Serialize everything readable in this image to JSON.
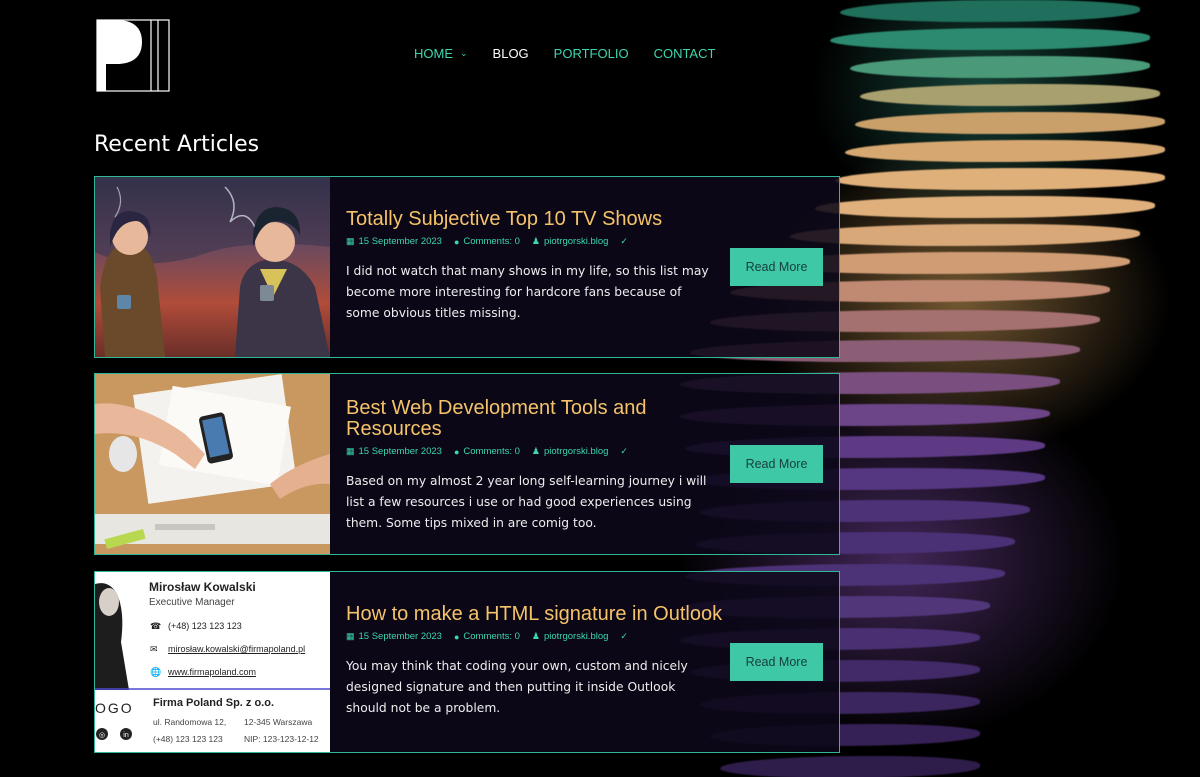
{
  "logo": {
    "text": "PI"
  },
  "nav": {
    "items": [
      {
        "label": "HOME",
        "active": false,
        "has_dropdown": true
      },
      {
        "label": "BLOG",
        "active": true,
        "has_dropdown": false
      },
      {
        "label": "PORTFOLIO",
        "active": false,
        "has_dropdown": false
      },
      {
        "label": "CONTACT",
        "active": false,
        "has_dropdown": false
      }
    ]
  },
  "section_title": "Recent Articles",
  "articles": [
    {
      "title": "Totally Subjective Top 10 TV Shows",
      "date": "15 September 2023",
      "comments": "Comments: 0",
      "author": "piotrgorski.blog",
      "excerpt": "I did not watch that many shows in my life, so this list may become more interesting for hardcore fans because of some obvious titles missing.",
      "read_more": "Read More",
      "image": "anime-characters-smoking"
    },
    {
      "title": "Best Web Development Tools and Resources",
      "date": "15 September 2023",
      "comments": "Comments: 0",
      "author": "piotrgorski.blog",
      "excerpt": "Based on my almost 2 year long self-learning journey i will list a few resources i use or had good experiences using them. Some tips mixed in are comig too.",
      "read_more": "Read More",
      "image": "desk-with-sketches-and-phone"
    },
    {
      "title": "How to make a HTML signature in Outlook",
      "date": "15 September 2023",
      "comments": "Comments: 0",
      "author": "piotrgorski.blog",
      "excerpt": "You may think that coding your own, custom and nicely designed signature and then putting it inside Outlook should not be a problem.",
      "read_more": "Read More",
      "image": "email-signature-sample"
    }
  ],
  "signature": {
    "name": "Mirosław Kowalski",
    "role": "Executive Manager",
    "phone": "(+48) 123 123 123",
    "email": "mirosław.kowalski@firmapoland.pl",
    "web": "www.firmapoland.com",
    "logo_text": "OGO",
    "company": "Firma Poland Sp. z o.o.",
    "address": "ul. Randomowa 12,",
    "city": "12-345 Warszawa",
    "phone2": "(+48) 123 123 123",
    "nip": "NIP: 123-123-12-12"
  },
  "colors": {
    "accent": "#3dd6b0",
    "title": "#f5c36a",
    "button": "#3ec8a6",
    "background": "#000000"
  }
}
